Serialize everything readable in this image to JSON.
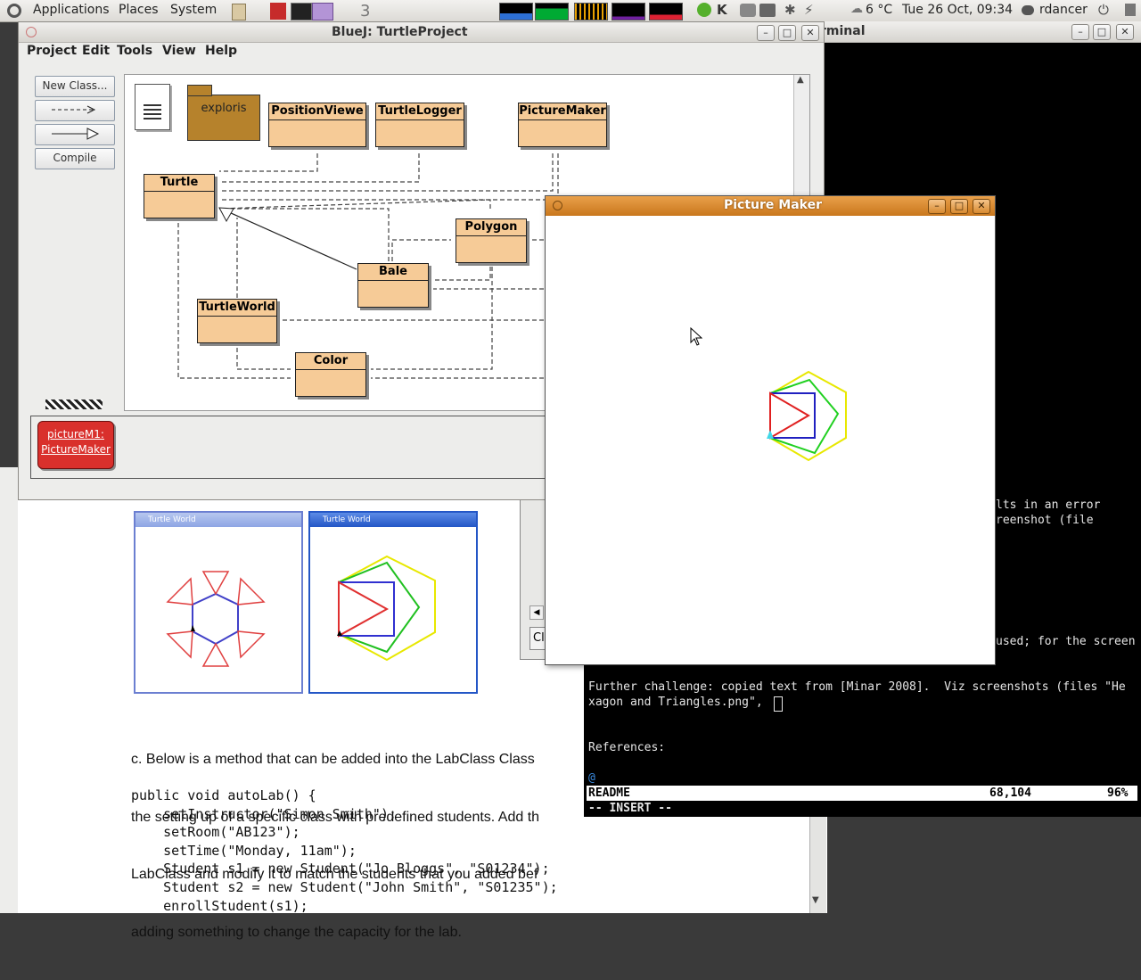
{
  "panel": {
    "menus": [
      "Applications",
      "Places",
      "System"
    ],
    "weather": "6 °C",
    "clock": "Tue 26 Oct, 09:34",
    "user": "rdancer"
  },
  "bluej": {
    "title": "BlueJ:  TurtleProject",
    "menus": [
      "Project",
      "Edit",
      "Tools",
      "View",
      "Help"
    ],
    "buttons": {
      "new_class": "New Class...",
      "compile": "Compile"
    },
    "package": "exploris",
    "classes": [
      "PositionViewe",
      "TurtleLogger",
      "PictureMaker",
      "Turtle",
      "Polygon",
      "Bale",
      "TurtleWorld",
      "Color"
    ],
    "object_bench": {
      "line1": "pictureM1:",
      "line2": "PictureMaker"
    }
  },
  "picture_maker": {
    "title": "Picture Maker"
  },
  "terminal": {
    "title": "rminal",
    "lines": [
      "lts in an error",
      "reenshot (file",
      "used; for the screen",
      "Further challenge: copied text from [Minar 2008].  Viz screenshots (files \"He",
      "xagon and Triangles.png\", ",
      "References:",
      "@"
    ],
    "status": {
      "file": "README",
      "pos": "68,104",
      "pct": "96%"
    },
    "mode": "-- INSERT --"
  },
  "document": {
    "tw_title": "Turtle World",
    "para": [
      "c. Below is a method that can be added into the LabClass Class",
      "the setting up of a specific class with predefined students. Add th",
      "LabClass and modify it to match the students that you added bef",
      "adding something to change the capacity for the lab."
    ],
    "code": [
      "public void autoLab() {",
      "    setInstructor(\"Simon Smith\");",
      "    setRoom(\"AB123\");",
      "    setTime(\"Monday, 11am\");",
      "    Student s1 = new Student(\"Jo Bloggs\", \"S01234\");",
      "    Student s2 = new Student(\"John Smith\", \"S01235\");",
      "    enrollStudent(s1);"
    ],
    "cl_fragment": "Cl"
  }
}
